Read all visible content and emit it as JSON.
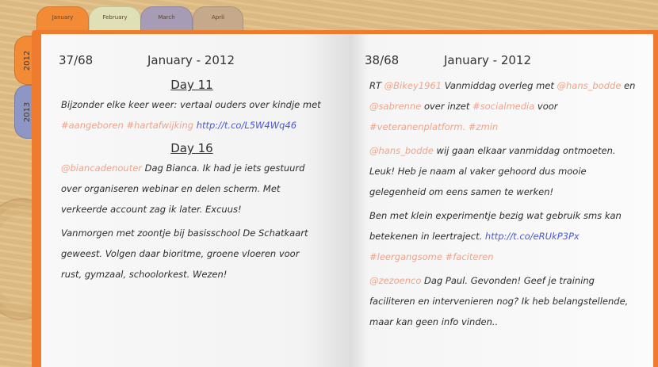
{
  "month_tabs": [
    {
      "label": "January",
      "color": "#f38a36"
    },
    {
      "label": "February",
      "color": "#dfe0b5"
    },
    {
      "label": "March",
      "color": "#a79cb5"
    },
    {
      "label": "April",
      "color": "#c6a98b"
    }
  ],
  "year_tabs": [
    {
      "label": "2012",
      "color": "#f38a36"
    },
    {
      "label": "2013",
      "color": "#8d96c4"
    }
  ],
  "left_page": {
    "page_num": "37/68",
    "month": "January - 2012",
    "day1": "Day 11",
    "entry1": [
      {
        "t": "Bijzonder elke keer weer: vertaal ouders over kindje met ",
        "c": "text"
      },
      {
        "t": "#aangeboren",
        "c": "hashtag"
      },
      {
        "t": " ",
        "c": "text"
      },
      {
        "t": "#hartafwijking",
        "c": "hashtag"
      },
      {
        "t": " ",
        "c": "text"
      },
      {
        "t": "http://t.co/L5W4Wq46",
        "c": "link"
      }
    ],
    "day2": "Day 16",
    "entry2": [
      {
        "t": "@biancadenouter",
        "c": "mention"
      },
      {
        "t": " Dag Bianca. Ik had je iets gestuurd over organiseren webinar en delen scherm. Met verkeerde account zag ik later. Excuus!",
        "c": "text"
      }
    ],
    "entry3": [
      {
        "t": "Vanmorgen met zoontje bij basisschool De Schatkaart geweest. Volgen daar bioritme, groene vloeren voor rust, gymzaal, schoolorkest. Wezen!",
        "c": "text"
      }
    ]
  },
  "right_page": {
    "page_num": "38/68",
    "month": "January - 2012",
    "entry1": [
      {
        "t": "RT ",
        "c": "text"
      },
      {
        "t": "@Bikey1961",
        "c": "mention"
      },
      {
        "t": " Vanmiddag overleg met ",
        "c": "text"
      },
      {
        "t": "@hans_bodde",
        "c": "mention"
      },
      {
        "t": " en ",
        "c": "text"
      },
      {
        "t": "@sabrenne",
        "c": "mention"
      },
      {
        "t": " over inzet ",
        "c": "text"
      },
      {
        "t": "#socialmedia",
        "c": "hashtag"
      },
      {
        "t": " voor ",
        "c": "text"
      },
      {
        "t": "#veteranenplatform.",
        "c": "hashtag"
      },
      {
        "t": " ",
        "c": "text"
      },
      {
        "t": "#zmin",
        "c": "hashtag"
      }
    ],
    "entry2": [
      {
        "t": "@hans_bodde",
        "c": "mention"
      },
      {
        "t": " wij gaan elkaar vanmiddag ontmoeten. Leuk! Heb je naam al vaker gehoord dus mooie gelegenheid om eens samen te werken!",
        "c": "text"
      }
    ],
    "entry3": [
      {
        "t": "Ben met klein experimentje bezig wat gebruik sms kan betekenen in leertraject. ",
        "c": "text"
      },
      {
        "t": "http://t.co/eRUkP3Px",
        "c": "link"
      },
      {
        "t": " ",
        "c": "text"
      },
      {
        "t": "#leergangsome",
        "c": "hashtag"
      },
      {
        "t": " ",
        "c": "text"
      },
      {
        "t": "#faciteren",
        "c": "hashtag"
      }
    ],
    "entry4": [
      {
        "t": "@zezoenco",
        "c": "mention"
      },
      {
        "t": " Dag Paul. Gevonden! Geef je training faciliteren en intervenieren nog? Ik heb belangstellende, maar kan geen info vinden..",
        "c": "text"
      }
    ]
  }
}
